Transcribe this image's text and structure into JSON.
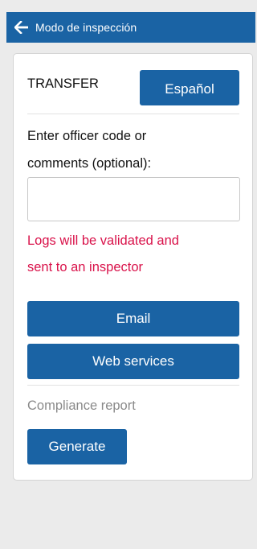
{
  "header": {
    "back_icon": "arrow-left-icon",
    "title": "Modo de inspección"
  },
  "transfer": {
    "label": "TRANSFER",
    "language_button": "Español"
  },
  "comments": {
    "prompt_line_1": "Enter officer code or",
    "prompt_line_2": "comments (optional):",
    "value": "",
    "placeholder": ""
  },
  "warning": {
    "line_1": "Logs will be validated and",
    "line_2": "sent to an inspector",
    "color": "#d9124a"
  },
  "actions": {
    "email_label": "Email",
    "web_services_label": "Web services"
  },
  "compliance": {
    "title": "Compliance report",
    "generate_label": "Generate"
  },
  "colors": {
    "accent": "#1a63a4",
    "background": "#ebebeb"
  }
}
